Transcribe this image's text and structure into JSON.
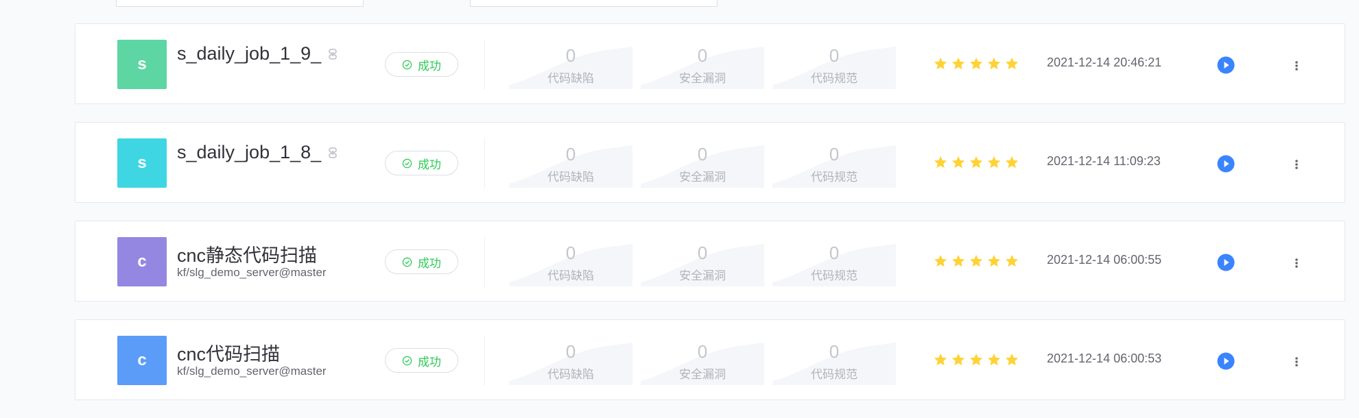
{
  "rows": [
    {
      "avatar_letter": "s",
      "avatar_color": "#5dd6a3",
      "name": "s_daily_job_1_9_",
      "repo": "",
      "has_link_icon": true,
      "status": "成功",
      "metrics": [
        {
          "value": "0",
          "label": "代码缺陷"
        },
        {
          "value": "0",
          "label": "安全漏洞"
        },
        {
          "value": "0",
          "label": "代码规范"
        }
      ],
      "stars": 5,
      "time": "2021-12-14 20:46:21"
    },
    {
      "avatar_letter": "s",
      "avatar_color": "#3fd6e4",
      "name": "s_daily_job_1_8_",
      "repo": "",
      "has_link_icon": true,
      "status": "成功",
      "metrics": [
        {
          "value": "0",
          "label": "代码缺陷"
        },
        {
          "value": "0",
          "label": "安全漏洞"
        },
        {
          "value": "0",
          "label": "代码规范"
        }
      ],
      "stars": 5,
      "time": "2021-12-14 11:09:23"
    },
    {
      "avatar_letter": "c",
      "avatar_color": "#9487e2",
      "name": "cnc静态代码扫描",
      "repo": "kf/slg_demo_server@master",
      "has_link_icon": false,
      "status": "成功",
      "metrics": [
        {
          "value": "0",
          "label": "代码缺陷"
        },
        {
          "value": "0",
          "label": "安全漏洞"
        },
        {
          "value": "0",
          "label": "代码规范"
        }
      ],
      "stars": 5,
      "time": "2021-12-14 06:00:55"
    },
    {
      "avatar_letter": "c",
      "avatar_color": "#5a9cf8",
      "name": "cnc代码扫描",
      "repo": "kf/slg_demo_server@master",
      "has_link_icon": false,
      "status": "成功",
      "metrics": [
        {
          "value": "0",
          "label": "代码缺陷"
        },
        {
          "value": "0",
          "label": "安全漏洞"
        },
        {
          "value": "0",
          "label": "代码规范"
        }
      ],
      "stars": 5,
      "time": "2021-12-14 06:00:53"
    }
  ],
  "icons": {
    "status": "check-circle-icon",
    "link": "link-icon",
    "star": "star-icon",
    "run": "play-icon",
    "more": "more-vertical-icon"
  },
  "colors": {
    "success": "#2dcb56",
    "star": "#ffd235",
    "run": "#3a84ff",
    "metric_bg": "#f5f6fa"
  }
}
